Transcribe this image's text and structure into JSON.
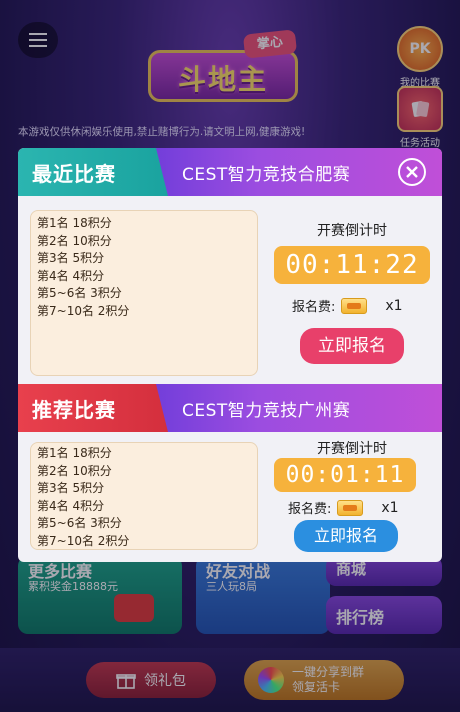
{
  "background": {
    "logo_title": "斗地主",
    "logo_badge": "掌心",
    "side_buttons": [
      {
        "icon": "pk-trophy-icon",
        "icon_text": "PK",
        "label": "我的比赛"
      },
      {
        "icon": "task-cards-icon",
        "icon_text": "",
        "label": "任务活动"
      }
    ],
    "notice": "本游戏仅供休闲娱乐使用,禁止赌博行为.请文明上网,健康游戏!",
    "cards": [
      {
        "title": "更多比赛",
        "subtitle": "累积奖金18888元"
      },
      {
        "title": "好友对战",
        "subtitle": "三人玩8局"
      },
      {
        "title": "商城",
        "subtitle": ""
      },
      {
        "title": "排行榜",
        "subtitle": ""
      }
    ],
    "gift_label": "领礼包",
    "share_line1": "一键分享到群",
    "share_line2": "领复活卡"
  },
  "modal": {
    "recent": {
      "section_label": "最近比赛",
      "title": "CEST智力竞技合肥赛",
      "ranks": [
        "第1名 18积分",
        "第2名 10积分",
        "第3名 5积分",
        "第4名 4积分",
        "第5~6名 3积分",
        "第7~10名 2积分"
      ],
      "countdown_label": "开赛倒计时",
      "countdown": "00:11:22",
      "fee_label": "报名费:",
      "fee_qty": "x1",
      "signup_label": "立即报名"
    },
    "recommended": {
      "section_label": "推荐比赛",
      "title": "CEST智力竞技广州赛",
      "ranks": [
        "第1名 18积分",
        "第2名 10积分",
        "第3名 5积分",
        "第4名 4积分",
        "第5~6名 3积分",
        "第7~10名 2积分"
      ],
      "countdown_label": "开赛倒计时",
      "countdown": "00:01:11",
      "fee_label": "报名费:",
      "fee_qty": "x1",
      "signup_label": "立即报名"
    }
  },
  "colors": {
    "recent_label": "#1aa39f",
    "recommended_label": "#d42f3d",
    "header_band": "#9b4de0",
    "timer": "#f6b23c",
    "signup_recent": "#e8406a",
    "signup_recommended": "#2b8fe0"
  }
}
